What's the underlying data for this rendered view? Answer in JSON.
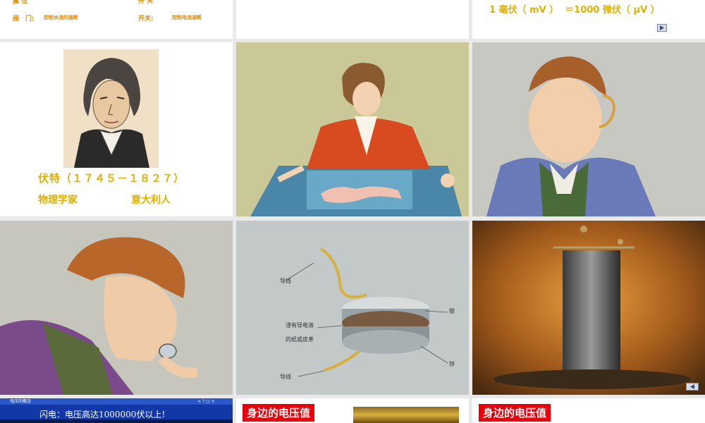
{
  "slides": {
    "s1": {
      "row1_left_label": "属 性",
      "row1_left_value": "控制水流的通断",
      "row1_right_label": "开 关",
      "row2_left_label": "阀　门:",
      "row2_left_value": "控制水流的通断",
      "row2_right_label": "开关:",
      "row2_right_value": "控制电流通断"
    },
    "s3": {
      "formula": "1 毫伏（ mV ）  ＝1000 微伏（ μV ）"
    },
    "s4": {
      "caption_line1": "伏特（１７４５－１８２７）",
      "caption_line2_left": "物理学家",
      "caption_line2_right": "意大利人"
    },
    "s8": {
      "label_wire_top": "导线",
      "label_silver": "银",
      "label_paper_line1": "浸有导电液",
      "label_paper_line2": "的纸或皮革",
      "label_zinc": "锌",
      "label_wire_bottom": "导线"
    },
    "s10": {
      "window_title": "电压的概念",
      "window_controls": "< ? □ ×",
      "lightning_text": "闪电：电压高达1000000伏以上!"
    },
    "s11": {
      "tag": "身边的电压值"
    },
    "s12": {
      "tag": "身边的电压值"
    }
  },
  "colors": {
    "caption_yellow": "#e0b000",
    "tag_red": "#e8000a",
    "window_blue": "#1238a8"
  }
}
